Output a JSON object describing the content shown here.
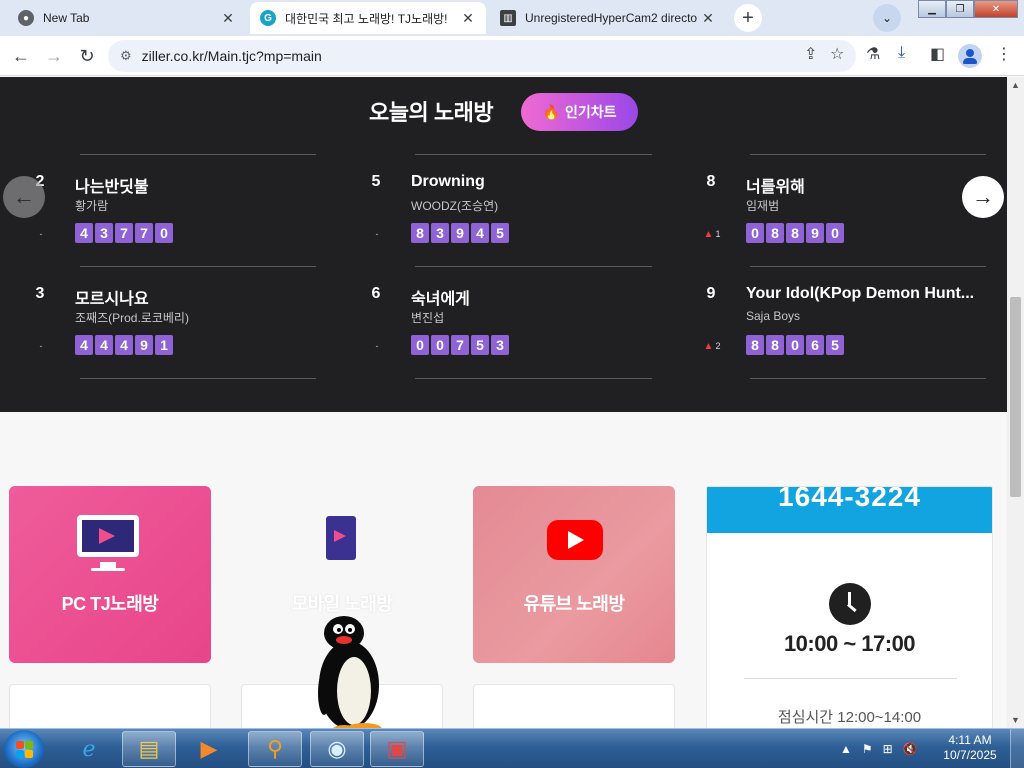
{
  "browser": {
    "tabs": [
      {
        "title": "New Tab",
        "icon": "chrome-icon"
      },
      {
        "title": "대한민국 최고 노래방! TJ노래방!",
        "icon": "tj-icon"
      },
      {
        "title": "UnregisteredHyperCam2 directo",
        "icon": "archive-icon"
      }
    ],
    "url": "ziller.co.kr/Main.tjc?mp=main"
  },
  "chart": {
    "title": "오늘의 노래방",
    "hot_button": "인기차트",
    "entries": [
      {
        "rank": "2",
        "song": "나는반딧불",
        "artist": "황가람",
        "change": "-",
        "code": [
          "4",
          "3",
          "7",
          "7",
          "0"
        ]
      },
      {
        "rank": "3",
        "song": "모르시나요",
        "artist": "조째즈(Prod.로코베리)",
        "change": "-",
        "code": [
          "4",
          "4",
          "4",
          "9",
          "1"
        ]
      },
      {
        "rank": "5",
        "song": "Drowning",
        "artist": "WOODZ(조승연)",
        "change": "-",
        "code": [
          "8",
          "3",
          "9",
          "4",
          "5"
        ]
      },
      {
        "rank": "6",
        "song": "숙녀에게",
        "artist": "변진섭",
        "change": "-",
        "code": [
          "0",
          "0",
          "7",
          "5",
          "3"
        ]
      },
      {
        "rank": "8",
        "song": "너를위해",
        "artist": "임재범",
        "change": "1",
        "change_dir": "up",
        "code": [
          "0",
          "8",
          "8",
          "9",
          "0"
        ]
      },
      {
        "rank": "9",
        "song": "Your Idol(KPop Demon Hunt...",
        "artist": "Saja Boys",
        "change": "2",
        "change_dir": "up",
        "code": [
          "8",
          "8",
          "0",
          "6",
          "5"
        ]
      }
    ]
  },
  "services": {
    "pc_label": "PC TJ노래방",
    "mobile_label": "모바일 노래방",
    "youtube_label": "유튜브 노래방"
  },
  "contact": {
    "phone": "1644-3224",
    "hours": "10:00 ~ 17:00",
    "lunch": "점심시간 12:00~14:00"
  },
  "taskbar": {
    "time": "4:11 AM",
    "date": "10/7/2025"
  },
  "colors": {
    "chart_bg": "#202022",
    "digit_bg": "#8f63d6",
    "accent_pink": "#ef5c9a",
    "contact_blue": "#12a4e0",
    "youtube_red": "#ff0000"
  }
}
